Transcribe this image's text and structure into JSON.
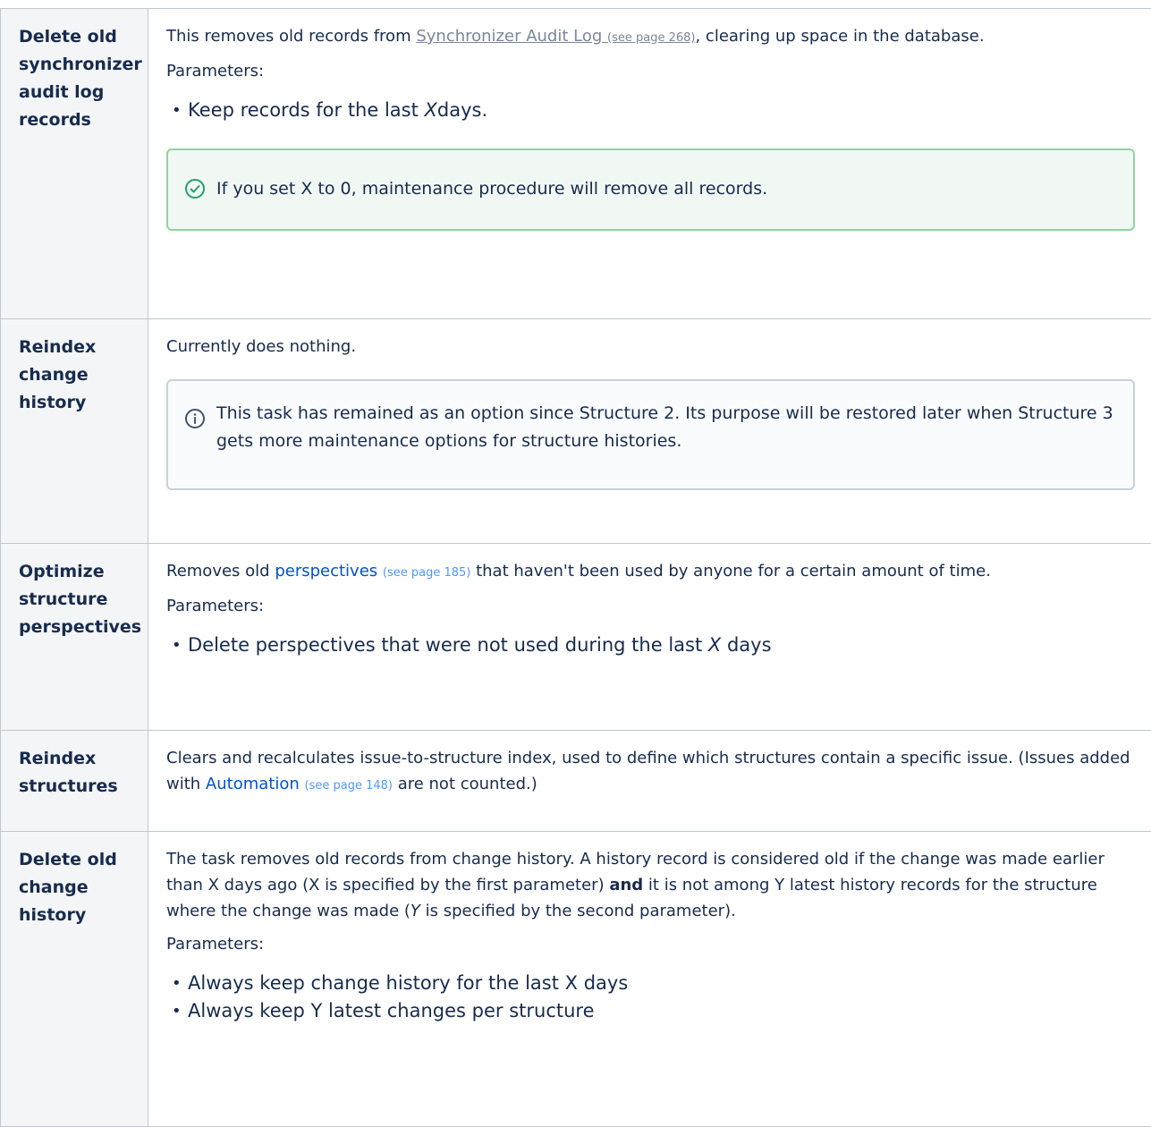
{
  "rows": [
    {
      "name": "Delete old synchronizer audit log records",
      "desc_pre": "This removes old records from ",
      "link": "Synchronizer Audit Log",
      "link_page": "(see page 268)",
      "desc_post": ", clearing up space in the database.",
      "params_label": "Parameters:",
      "param_pre": "Keep records for the last ",
      "param_var": "X",
      "param_post": "days.",
      "note": "If you set X to 0, maintenance procedure will remove all records."
    },
    {
      "name": "Reindex change history",
      "desc": "Currently does nothing.",
      "note": "This task has remained as an option since Structure 2. Its purpose will be restored later when Structure 3 gets more maintenance options for structure histories."
    },
    {
      "name": "Optimize structure perspectives",
      "desc_pre": "Removes old ",
      "link": "perspectives",
      "link_page": "(see page 185)",
      "desc_post": " that haven't been used by anyone for a certain amount of time.",
      "params_label": "Parameters:",
      "param_pre": "Delete perspectives that were not used during the last ",
      "param_var": "X",
      "param_post": " days"
    },
    {
      "name": "Reindex structures",
      "desc_pre": "Clears and recalculates issue-to-structure index, used to define which structures contain a specific issue. (Issues added with ",
      "link": "Automation",
      "link_page": "(see page 148)",
      "desc_post": " are not counted.)"
    },
    {
      "name": "Delete old change history",
      "desc_a": "The task removes old records from change history. A history record is considered old if the change was made earlier than X days ago (X is specified by the first parameter) ",
      "desc_bold": "and",
      "desc_b": " it is not among Y latest history records for the structure where the change was made (",
      "desc_var": "Y",
      "desc_c": " is specified by the second parameter).",
      "params_label": "Parameters:",
      "params": [
        "Always keep change history for the last X days",
        "Always keep Y latest changes per structure"
      ]
    }
  ],
  "icons": {
    "success": "check-circle-icon",
    "info": "info-circle-icon"
  },
  "colors": {
    "success_border": "#8fd3a5",
    "info_border": "#c7d1db",
    "link": "#0052cc"
  }
}
